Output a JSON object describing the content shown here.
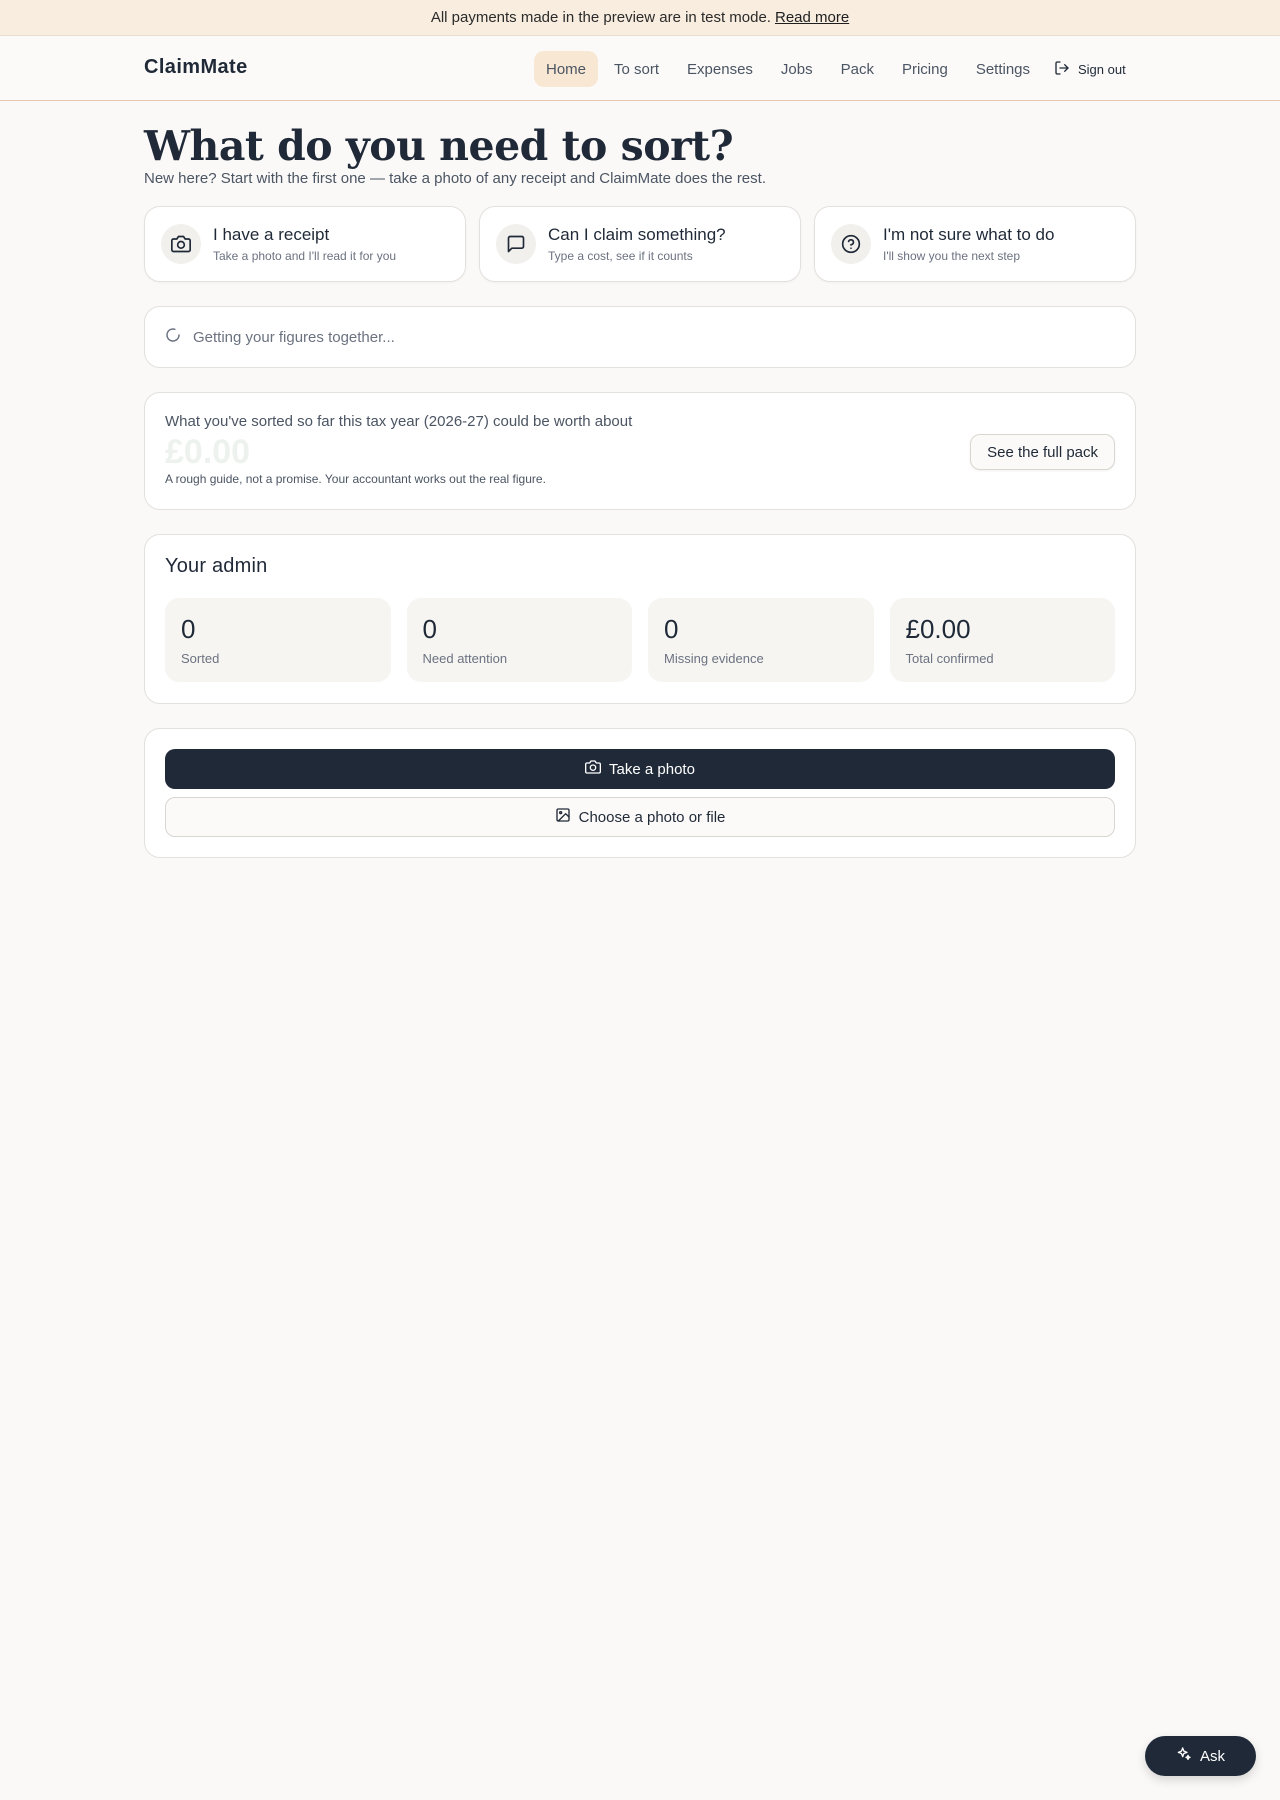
{
  "banner": {
    "text": "All payments made in the preview are in test mode.",
    "link": "Read more"
  },
  "header": {
    "brand": "ClaimMate",
    "nav": [
      "Home",
      "To sort",
      "Expenses",
      "Jobs",
      "Pack",
      "Pricing",
      "Settings"
    ],
    "active_nav": "Home",
    "sign_out": "Sign out"
  },
  "main": {
    "title": "What do you need to sort?",
    "subtitle": "New here? Start with the first one — take a photo of any receipt and ClaimMate does the rest.",
    "cards": [
      {
        "title": "I have a receipt",
        "sub": "Take a photo and I'll read it for you",
        "icon": "camera-icon"
      },
      {
        "title": "Can I claim something?",
        "sub": "Type a cost, see if it counts",
        "icon": "chat-icon"
      },
      {
        "title": "I'm not sure what to do",
        "sub": "I'll show you the next step",
        "icon": "help-circle-icon"
      }
    ],
    "loading": "Getting your figures together...",
    "worth": {
      "label": "What you've sorted so far this tax year (2026-27) could be worth about",
      "amount": "£0.00",
      "note": "A rough guide, not a promise. Your accountant works out the real figure.",
      "button": "See the full pack"
    },
    "admin": {
      "title": "Your admin",
      "stats": [
        {
          "value": "0",
          "label": "Sorted"
        },
        {
          "value": "0",
          "label": "Need attention"
        },
        {
          "value": "0",
          "label": "Missing evidence"
        },
        {
          "value": "£0.00",
          "label": "Total confirmed"
        }
      ]
    },
    "upload": {
      "primary": "Take a photo",
      "secondary": "Choose a photo or file"
    }
  },
  "ask": {
    "label": "Ask"
  },
  "colors": {
    "accent": "#1f2937",
    "banner_bg": "#f8eddf",
    "active_nav_bg": "#f8e7d3",
    "page_bg": "#faf9f7"
  }
}
